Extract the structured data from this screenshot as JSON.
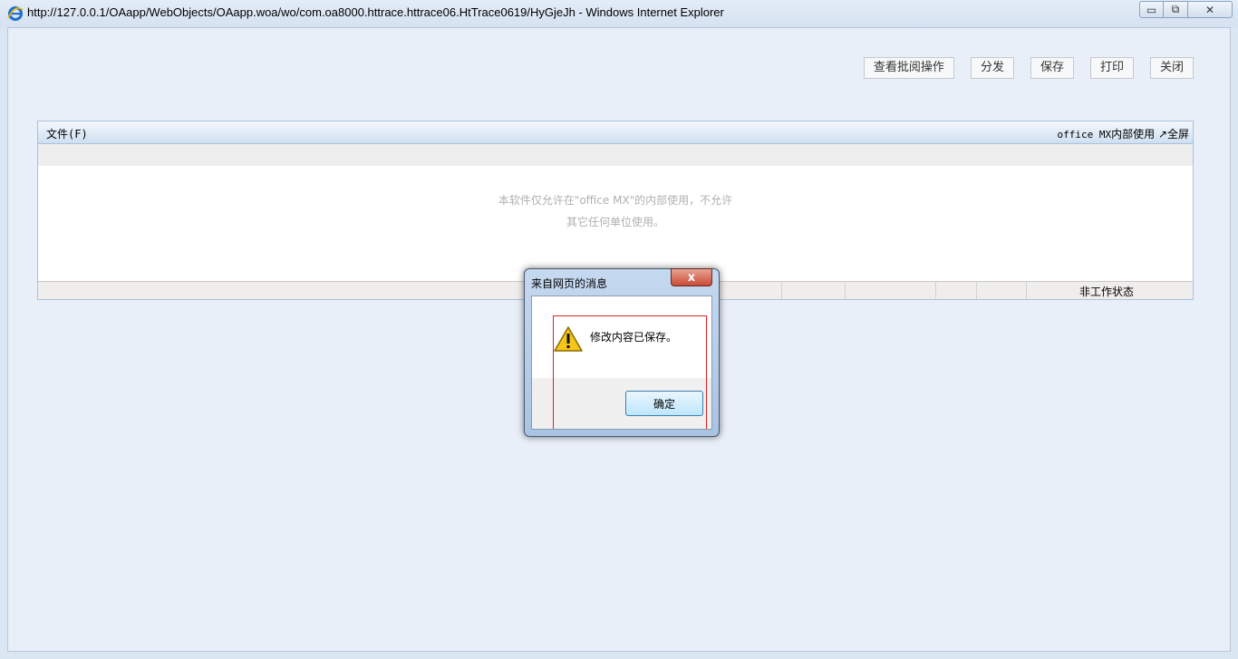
{
  "window": {
    "title": "http://127.0.0.1/OAapp/WebObjects/OAapp.woa/wo/com.oa8000.httrace.httrace06.HtTrace0619/HyGjeJh - Windows Internet Explorer",
    "min_label": "▭",
    "max_label": "⧉",
    "close_label": "✕"
  },
  "toolbar": {
    "view_review_label": "查看批阅操作",
    "distribute_label": "分发",
    "save_label": "保存",
    "print_label": "打印",
    "close_label": "关闭"
  },
  "office": {
    "menu_file": "文件(F)",
    "menu_right_prefix": "office MX",
    "menu_right_suffix": "内部使用",
    "fullscreen": "↗全屏",
    "notice_line1": "本软件仅允许在\"office MX\"的内部使用，不允许",
    "notice_line2": "其它任何单位使用。",
    "status_text": "非工作状态"
  },
  "dialog": {
    "title": "来自网页的消息",
    "close_label": "x",
    "message": "修改内容已保存。",
    "ok_label": "确定",
    "icon": "warning-icon"
  },
  "colors": {
    "window_bg": "#e9eff9",
    "warn_yellow": "#f5c518",
    "highlight_red": "#e21f1f"
  }
}
